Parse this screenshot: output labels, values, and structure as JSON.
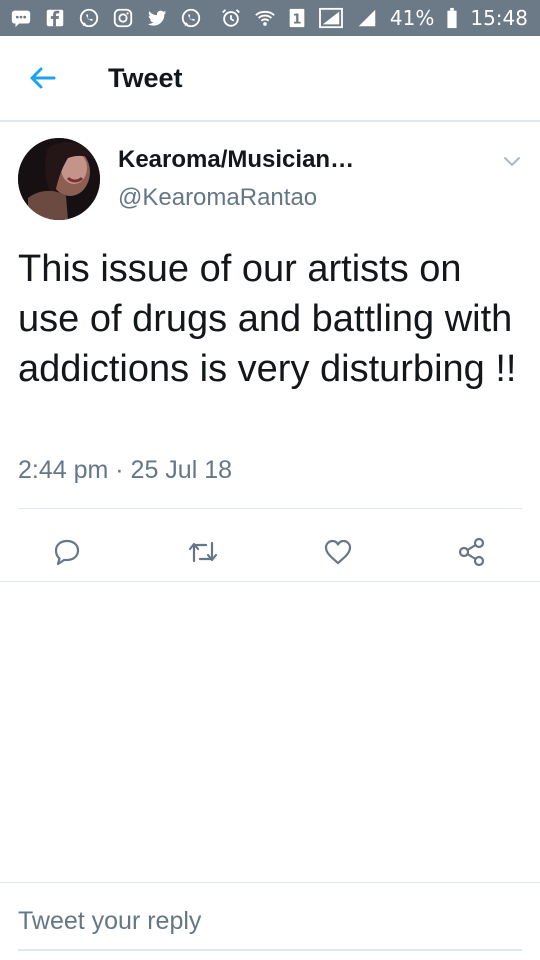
{
  "status_bar": {
    "battery_percent": "41%",
    "time": "15:48",
    "sim_number": "1",
    "left_icons": [
      "chat-bubble-icon",
      "facebook-icon",
      "whatsapp-icon",
      "instagram-icon",
      "twitter-icon",
      "whatsapp-icon"
    ],
    "right_icons": [
      "alarm-icon",
      "wifi-icon",
      "sim-icon",
      "signal-icon",
      "signal-icon",
      "battery-icon"
    ],
    "color": "#6b7a86"
  },
  "header": {
    "title": "Tweet",
    "back_icon": "arrow-left-icon",
    "accent": "#1da1f2"
  },
  "tweet": {
    "display_name": "Kearoma/Musician…",
    "handle": "@KearomaRantao",
    "text": "This issue of our artists on use of drugs and battling with addictions is very disturbing !!",
    "timestamp": "2:44 pm · 25 Jul 18",
    "actions": [
      "reply-icon",
      "retweet-icon",
      "like-icon",
      "share-icon"
    ]
  },
  "reply": {
    "placeholder": "Tweet your reply"
  }
}
